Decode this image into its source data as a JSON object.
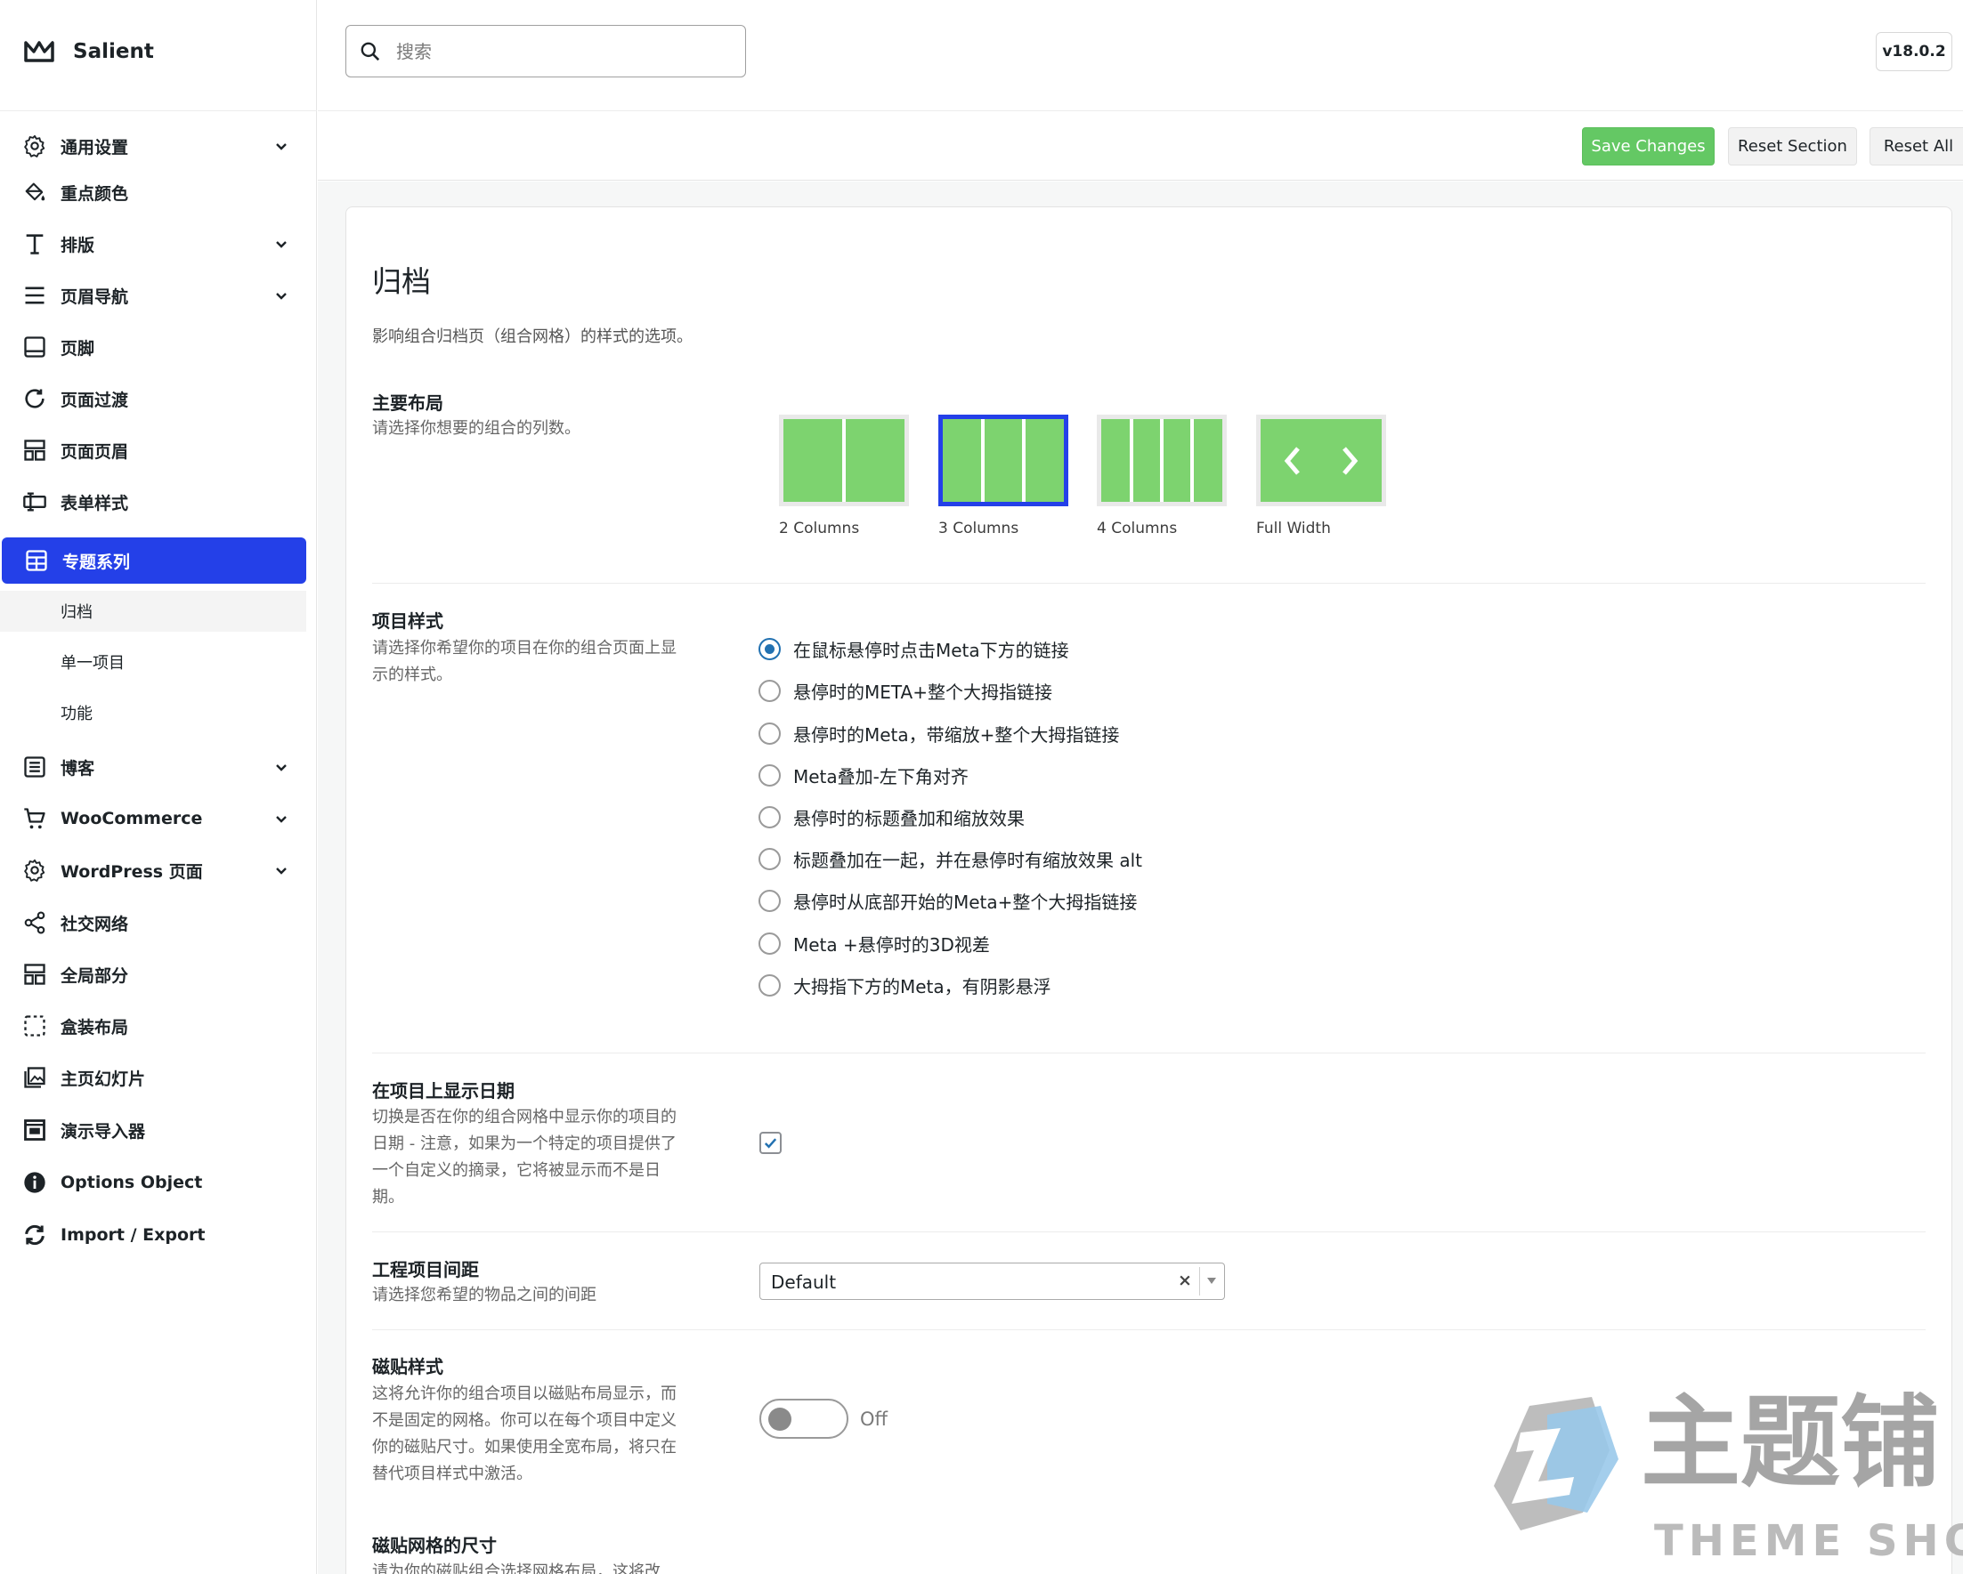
{
  "app": {
    "name": "Salient",
    "version": "v18.0.2"
  },
  "search": {
    "placeholder": "搜索",
    "value": ""
  },
  "toolbar": {
    "save_label": "Save Changes",
    "reset_section_label": "Reset Section",
    "reset_all_label": "Reset All"
  },
  "sidebar": {
    "items": [
      {
        "label": "通用设置",
        "icon": "gear-icon",
        "expandable": true
      },
      {
        "label": "重点颜色",
        "icon": "paint-bucket-icon",
        "expandable": false
      },
      {
        "label": "排版",
        "icon": "typography-icon",
        "expandable": true
      },
      {
        "label": "页眉导航",
        "icon": "menu-icon",
        "expandable": true
      },
      {
        "label": "页脚",
        "icon": "footer-icon",
        "expandable": false
      },
      {
        "label": "页面过渡",
        "icon": "refresh-icon",
        "expandable": false
      },
      {
        "label": "页面页眉",
        "icon": "layout-icon",
        "expandable": false
      },
      {
        "label": "表单样式",
        "icon": "form-icon",
        "expandable": false
      },
      {
        "label": "专题系列",
        "icon": "portfolio-icon",
        "expandable": false,
        "active": true
      },
      {
        "label": "博客",
        "icon": "document-icon",
        "expandable": true
      },
      {
        "label": "WooCommerce",
        "icon": "cart-icon",
        "expandable": true
      },
      {
        "label": "WordPress 页面",
        "icon": "gear-icon",
        "expandable": true
      },
      {
        "label": "社交网络",
        "icon": "share-icon",
        "expandable": false
      },
      {
        "label": "全局部分",
        "icon": "layout-icon",
        "expandable": false
      },
      {
        "label": "盒装布局",
        "icon": "dashed-box-icon",
        "expandable": false
      },
      {
        "label": "主页幻灯片",
        "icon": "gallery-icon",
        "expandable": false
      },
      {
        "label": "演示导入器",
        "icon": "import-icon",
        "expandable": false
      },
      {
        "label": "Options Object",
        "icon": "info-icon",
        "expandable": false
      },
      {
        "label": "Import / Export",
        "icon": "sync-icon",
        "expandable": false
      }
    ],
    "sub_items": [
      {
        "label": "归档",
        "current": true
      },
      {
        "label": "单一项目",
        "current": false
      },
      {
        "label": "功能",
        "current": false
      }
    ]
  },
  "section": {
    "title": "归档",
    "description": "影响组合归档页（组合网格）的样式的选项。"
  },
  "layout_option": {
    "label": "主要布局",
    "description": "请选择你想要的组合的列数。",
    "choices": [
      "2 Columns",
      "3 Columns",
      "4 Columns",
      "Full Width"
    ],
    "selected": "3 Columns",
    "tile_color": "#7dd36f"
  },
  "item_style": {
    "label": "项目样式",
    "description": "请选择你希望你的项目在你的组合页面上显示的样式。",
    "choices": [
      "在鼠标悬停时点击Meta下方的链接",
      "悬停时的META+整个大拇指链接",
      "悬停时的Meta，带缩放+整个大拇指链接",
      "Meta叠加-左下角对齐",
      "悬停时的标题叠加和缩放效果",
      "标题叠加在一起，并在悬停时有缩放效果 alt",
      "悬停时从底部开始的Meta+整个大拇指链接",
      "Meta +悬停时的3D视差",
      "大拇指下方的Meta，有阴影悬浮"
    ],
    "selected_index": 0
  },
  "show_date": {
    "label": "在项目上显示日期",
    "description": "切换是否在你的组合网格中显示你的项目的日期 - 注意，如果为一个特定的项目提供了一个自定义的摘录，它将被显示而不是日期。",
    "checked": true
  },
  "item_spacing": {
    "label": "工程项目间距",
    "description": "请选择您希望的物品之间的间距",
    "value": "Default",
    "clear_symbol": "×"
  },
  "masonry": {
    "label": "磁贴样式",
    "description": "这将允许你的组合项目以磁贴布局显示，而不是固定的网格。你可以在每个项目中定义你的磁贴尺寸。如果使用全宽布局，将只在替代项目样式中激活。",
    "state": "Off"
  },
  "masonry_grid": {
    "label": "磁贴网格的尺寸",
    "description": "请为你的磁贴组合选择网格布局，这将改"
  },
  "watermark": {
    "text_cn": "主题铺",
    "text_en": "THEME SHOP"
  },
  "colors": {
    "accent": "#2440e8",
    "save": "#64c864",
    "radio": "#2271b1"
  }
}
